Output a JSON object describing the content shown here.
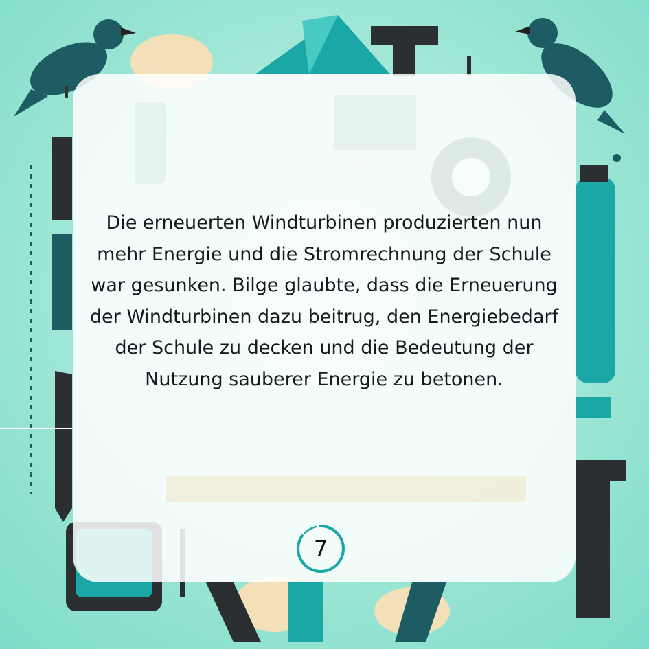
{
  "story": {
    "text": "Die erneuerten Windturbinen produzierten nun mehr Energie und die Stromrechnung der Schule war gesunken. Bilge glaubte, dass die Erneuerung der Windturbinen dazu beitrug, den Energiebedarf der Schule zu decken und die Bedeutung der Nutzung sauberer Energie zu betonen."
  },
  "page": {
    "number": "7"
  },
  "colors": {
    "teal": "#1aa7a6",
    "dark_teal": "#1d5c63",
    "charcoal": "#2b2f31",
    "cream": "#f3dfb8",
    "card": "#ffffff"
  },
  "icons": [
    "crow-illustration",
    "crow-illustration",
    "gear-icon",
    "bottle-illustration",
    "paper-plane-illustration",
    "letter-t-shape",
    "letter-i-shape",
    "ruler-illustration"
  ]
}
